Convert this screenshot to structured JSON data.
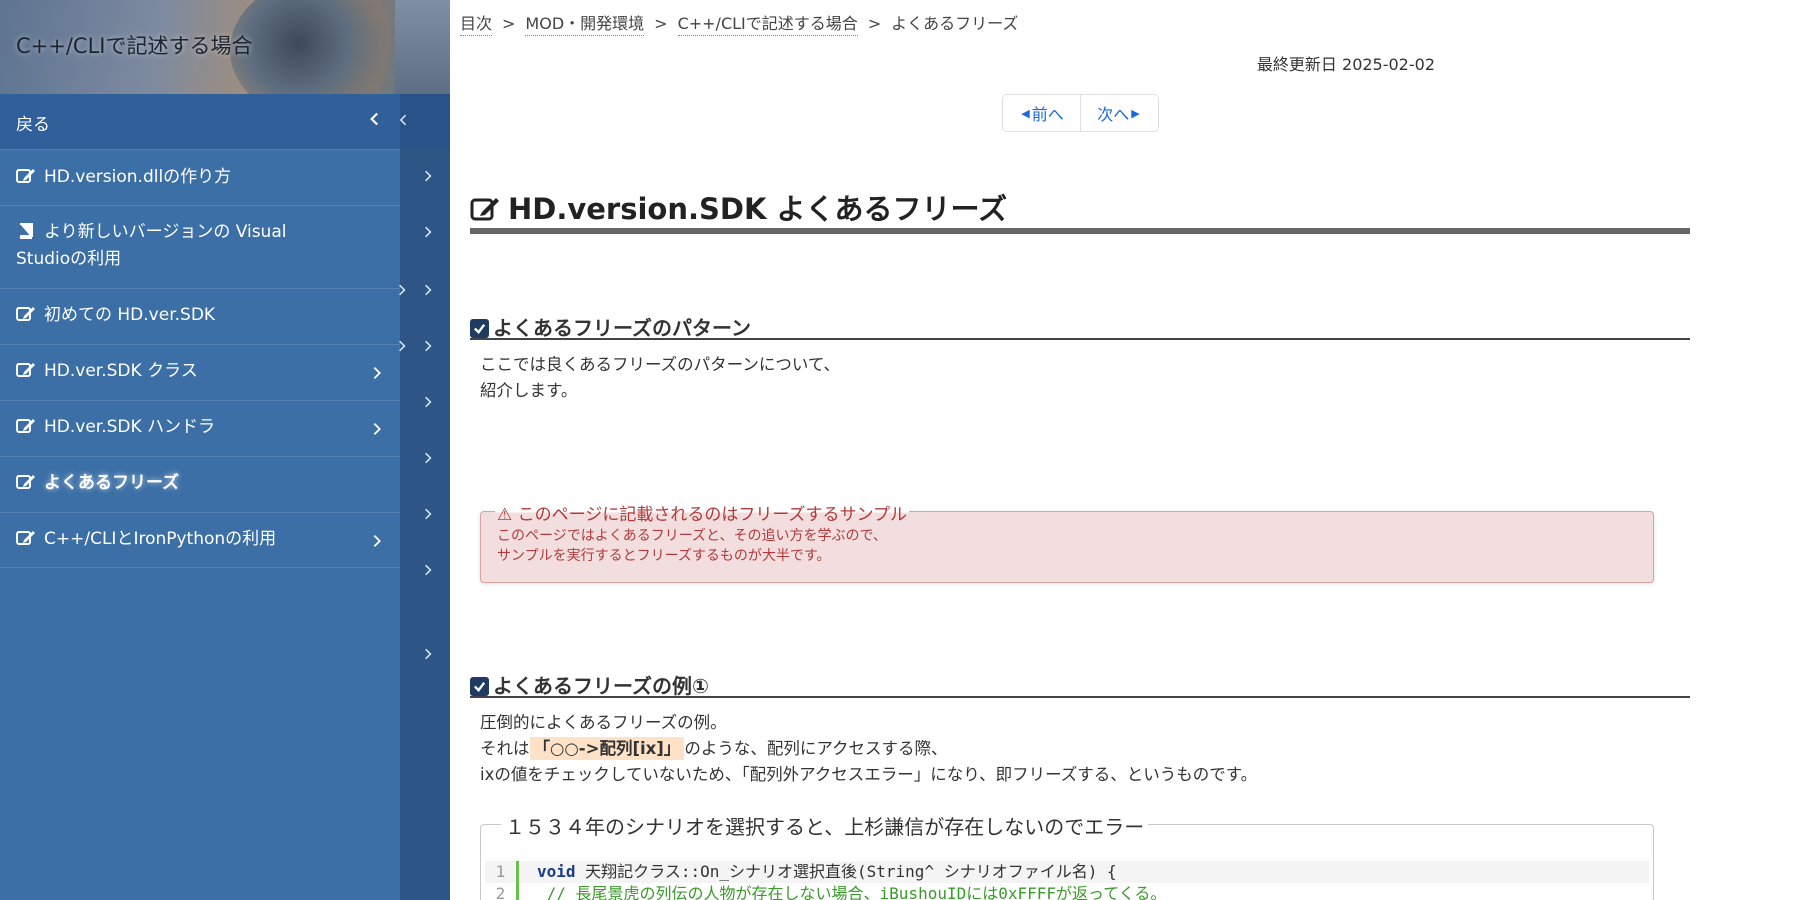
{
  "sidebar": {
    "title": "C++/CLIで記述する場合",
    "back_label": "戻る",
    "items": [
      {
        "label": "HD.version.dllの作り方",
        "icon": "edit-icon",
        "chevron": false
      },
      {
        "label": "より新しいバージョンの Visual Studioの利用",
        "line1": "より新しいバージョンの Visual",
        "line2": "Studioの利用",
        "icon": "book-icon",
        "chevron": false
      },
      {
        "label": "初めての HD.ver.SDK",
        "icon": "edit-icon",
        "chevron": false
      },
      {
        "label": "HD.ver.SDK クラス",
        "icon": "edit-icon",
        "chevron": true
      },
      {
        "label": "HD.ver.SDK ハンドラ",
        "icon": "edit-icon",
        "chevron": true
      },
      {
        "label": "よくあるフリーズ",
        "icon": "edit-icon",
        "chevron": false,
        "active": true
      },
      {
        "label": "C++/CLIとIronPythonの利用",
        "icon": "edit-icon",
        "chevron": true
      }
    ]
  },
  "breadcrumb": [
    "目次",
    "MOD・開発環境",
    "C++/CLIで記述する場合",
    "よくあるフリーズ"
  ],
  "updated": "最終更新日 2025-02-02",
  "pager": {
    "prev": "前へ",
    "next": "次へ"
  },
  "page_title": "HD.version.SDK よくあるフリーズ",
  "section1": {
    "heading": "よくあるフリーズのパターン",
    "para_line1": "ここでは良くあるフリーズのパターンについて、",
    "para_line2": "紹介します。"
  },
  "alert": {
    "title": "このページに記載されるのはフリーズするサンプル",
    "line1": "このページではよくあるフリーズと、その追い方を学ぶので、",
    "line2": "サンプルを実行するとフリーズするものが大半です。"
  },
  "section2": {
    "heading": "よくあるフリーズの例①",
    "line1": "圧倒的によくあるフリーズの例。",
    "line2_pre": "それは",
    "line2_highlight": "「○○->配列[ix]」",
    "line2_post": "のような、配列にアクセスする際、",
    "line3": "ixの値をチェックしていないため、「配列外アクセスエラー」になり、即フリーズする、というものです。",
    "code_legend": "１５３４年のシナリオを選択すると、上杉謙信が存在しないのでエラー",
    "code": [
      {
        "ln": "1",
        "kw": "void",
        "text": " 天翔記クラス::On_シナリオ選択直後(String^ シナリオファイル名) {"
      },
      {
        "ln": "2",
        "comment": "  // 長尾景虎の列伝の人物が存在しない場合、iBushouIDには0xFFFFが返ってくる。"
      }
    ]
  },
  "colors": {
    "sidebar_bg": "#3b6fa5",
    "sidebar_back_bg": "#2f609a",
    "rail_bg": "#2d5585",
    "link": "#1a6ad8",
    "alert_bg": "#f2dede",
    "alert_text": "#b33a3a",
    "highlight_bg": "#fde2c8",
    "heading_check": "#1f3b5f",
    "code_gutter": "#6cc04a",
    "code_comment": "#3a9a2a"
  }
}
